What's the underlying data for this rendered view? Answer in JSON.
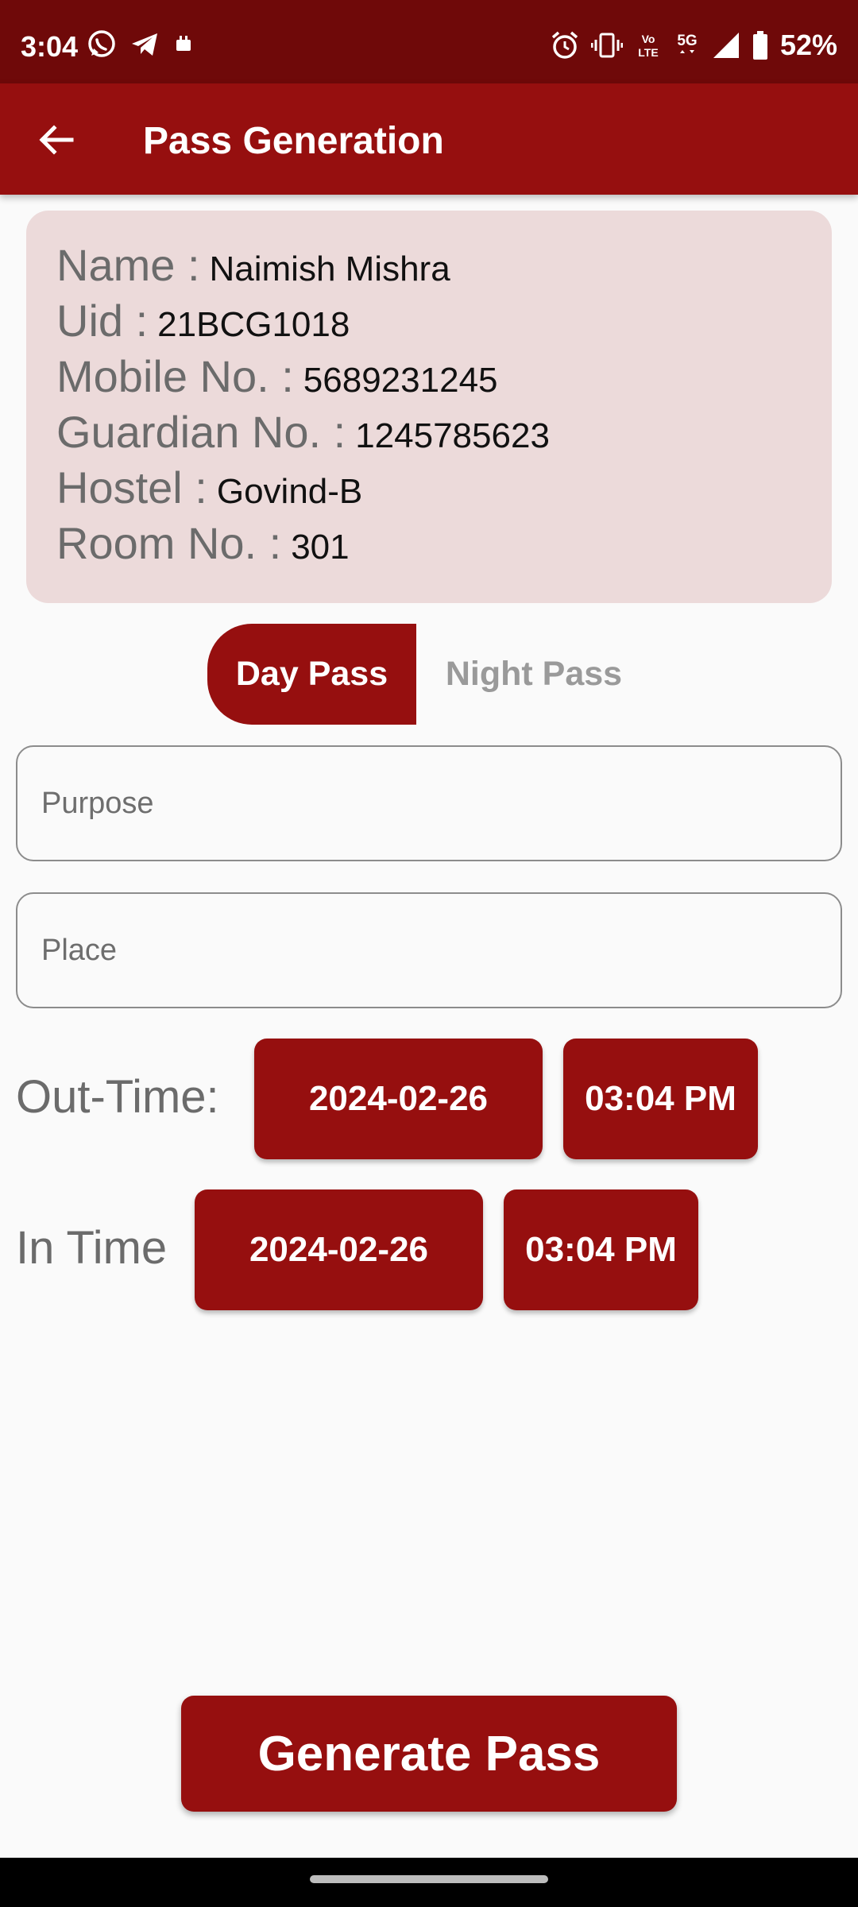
{
  "status_bar": {
    "time": "3:04",
    "battery": "52%",
    "network": "5G",
    "left_icons": [
      "whatsapp-icon",
      "telegram-icon",
      "notification-icon"
    ],
    "right_icons": [
      "alarm-icon",
      "vibrate-icon",
      "volte-icon",
      "5g-icon",
      "signal-icon",
      "battery-icon"
    ]
  },
  "app_bar": {
    "title": "Pass Generation",
    "back_icon": "arrow-left-icon"
  },
  "info": {
    "name_label": "Name :",
    "name": "Naimish Mishra",
    "uid_label": "Uid :",
    "uid": "21BCG1018",
    "mobile_label": "Mobile No. :",
    "mobile": "5689231245",
    "guardian_label": "Guardian No. :",
    "guardian": "1245785623",
    "hostel_label": "Hostel :",
    "hostel": "Govind-B",
    "room_label": "Room No. :",
    "room": "301"
  },
  "pass_type": {
    "options": [
      "Day Pass",
      "Night Pass"
    ],
    "selected": "Day Pass"
  },
  "form": {
    "purpose_placeholder": "Purpose",
    "purpose_value": "",
    "place_placeholder": "Place",
    "place_value": ""
  },
  "out_time": {
    "label": "Out-Time:",
    "date": "2024-02-26",
    "time": "03:04 PM"
  },
  "in_time": {
    "label": "In Time",
    "date": "2024-02-26",
    "time": "03:04 PM"
  },
  "generate_button": "Generate Pass",
  "colors": {
    "status_bar": "#6f0909",
    "primary": "#960f0f",
    "card": "#ecdada",
    "background": "#fafafa"
  }
}
